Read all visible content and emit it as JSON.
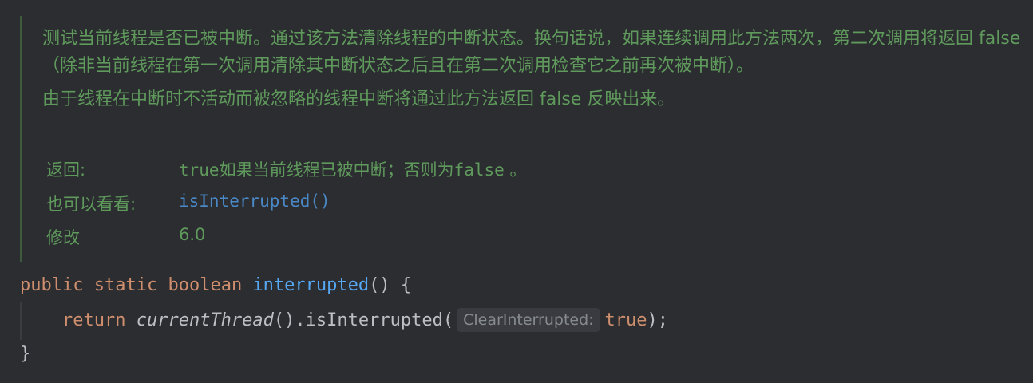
{
  "doc": {
    "description_1": "测试当前线程是否已被中断。通过该方法清除线程的中断状态。换句话说，如果连续调用此方法两次，第二次调用将返回 false（除非当前线程在第一次调用清除其中断状态之后且在第二次调用检查它之前再次被中断）。",
    "description_2": "由于线程在中断时不活动而被忽略的线程中断将通过此方法返回 false 反映出来。",
    "returns_label": "返回:",
    "returns_true": "true",
    "returns_text_1": "如果当前线程已被中断；否则为",
    "returns_false": "false",
    "returns_text_2": " 。",
    "see_also_label": "也可以看看:",
    "see_also_link": "isInterrupted()",
    "modified_label": "修改",
    "modified_value": "6.0"
  },
  "code": {
    "line1": {
      "kw_public": "public",
      "kw_static": "static",
      "kw_boolean": "boolean",
      "method_name": "interrupted",
      "rest": "() {"
    },
    "line2": {
      "kw_return": "return",
      "call": "currentThread",
      "mid": "().isInterrupted(",
      "param_hint": "ClearInterrupted:",
      "arg_true": "true",
      "end": ");"
    },
    "line3": {
      "brace": "}"
    }
  },
  "colors": {
    "background": "#2b2d30",
    "doc_text": "#5f9a5c",
    "keyword": "#cf8e6d",
    "method_decl": "#56a8f5",
    "link": "#4a88c7",
    "hint_bg": "#393b40"
  }
}
